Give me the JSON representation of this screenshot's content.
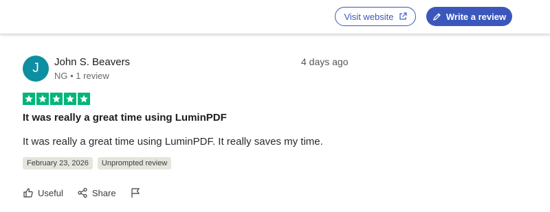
{
  "header": {
    "visit_label": "Visit website",
    "write_label": "Write a review"
  },
  "review": {
    "avatar_initial": "J",
    "reviewer_name": "John S. Beavers",
    "country": "NG",
    "review_count": "1 review",
    "posted_ago": "4 days ago",
    "rating": 5,
    "title": "It was really a great time using LuminPDF",
    "body": "It was really a great time using LuminPDF. It really saves my time.",
    "date_tag": "February 23, 2026",
    "type_tag": "Unprompted review"
  },
  "actions": {
    "useful_label": "Useful",
    "share_label": "Share"
  },
  "colors": {
    "brand_blue": "#3c57bc",
    "star_green": "#00b67a",
    "avatar_teal": "#0e8ea1",
    "tag_bg": "#e5e5dd"
  },
  "icons": [
    "external-link-icon",
    "pencil-icon",
    "star-icon",
    "thumbs-up-icon",
    "share-icon",
    "flag-icon"
  ]
}
